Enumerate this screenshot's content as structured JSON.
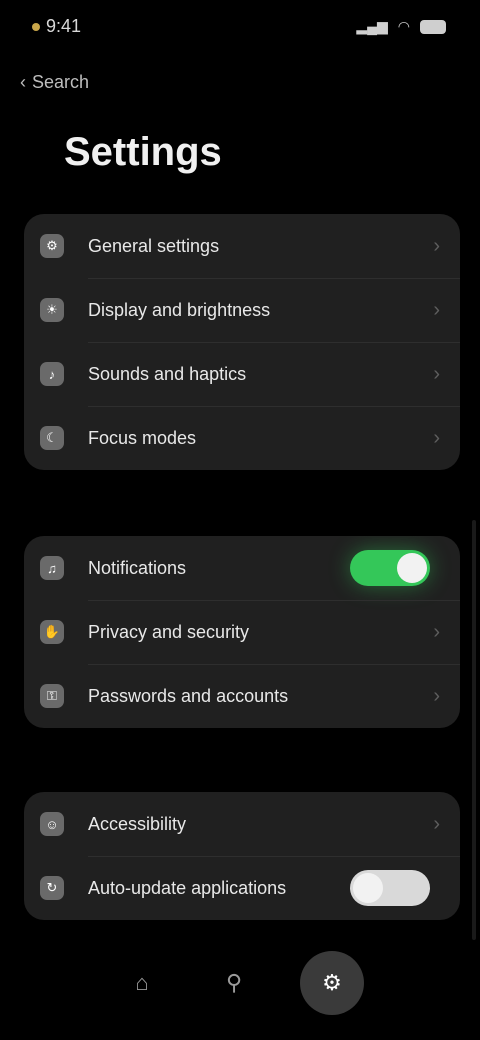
{
  "status_bar": {
    "time": "9:41",
    "signal": "▂▄▆",
    "wifi": "◠"
  },
  "header": {
    "back_label": "Search",
    "title": "Settings"
  },
  "group_1": {
    "items": [
      {
        "label": "General settings",
        "icon": "gear-icon",
        "glyph": "⚙"
      },
      {
        "label": "Display and brightness",
        "icon": "sun-icon",
        "glyph": "☀"
      },
      {
        "label": "Sounds and haptics",
        "icon": "speaker-icon",
        "glyph": "♪"
      },
      {
        "label": "Focus modes",
        "icon": "moon-icon",
        "glyph": "☾"
      }
    ]
  },
  "group_2": {
    "items": [
      {
        "label": "Notifications",
        "icon": "bell-icon",
        "glyph": "♫",
        "toggle": "on"
      },
      {
        "label": "Privacy and security",
        "icon": "hand-icon",
        "glyph": "✋"
      },
      {
        "label": "Passwords and accounts",
        "icon": "key-icon",
        "glyph": "⚿"
      }
    ]
  },
  "group_3": {
    "items": [
      {
        "label": "Accessibility",
        "icon": "person-icon",
        "glyph": "☺"
      },
      {
        "label": "Auto-update applications",
        "icon": "refresh-icon",
        "glyph": "↻",
        "toggle": "off"
      }
    ]
  },
  "bottom_nav": {
    "items": [
      {
        "icon": "home-icon",
        "glyph": "⌂"
      },
      {
        "icon": "search-icon",
        "glyph": "⚲"
      },
      {
        "icon": "settings-icon",
        "glyph": "⚙"
      }
    ]
  },
  "colors": {
    "background": "#000000",
    "card": "#202020",
    "toggle_on": "#34c759"
  }
}
